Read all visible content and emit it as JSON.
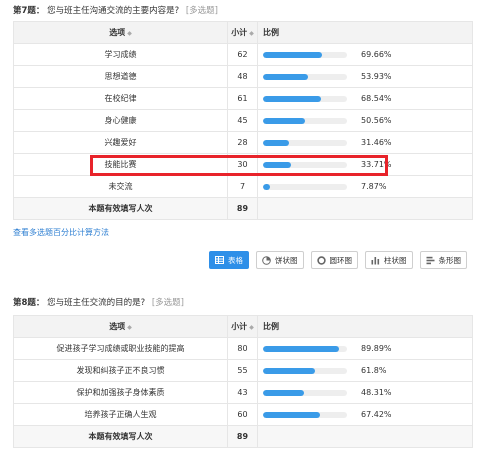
{
  "q7": {
    "number": "第7题：",
    "question": "您与班主任沟通交流的主要内容是?",
    "tag": "[多选题]",
    "headers": {
      "option": "选项",
      "count": "小计",
      "ratio": "比例"
    },
    "rows": [
      {
        "option": "学习成绩",
        "count": "62",
        "percent": "69.66%",
        "fill": 0.6966
      },
      {
        "option": "思想道德",
        "count": "48",
        "percent": "53.93%",
        "fill": 0.5393
      },
      {
        "option": "在校纪律",
        "count": "61",
        "percent": "68.54%",
        "fill": 0.6854
      },
      {
        "option": "身心健康",
        "count": "45",
        "percent": "50.56%",
        "fill": 0.5056
      },
      {
        "option": "兴趣爱好",
        "count": "28",
        "percent": "31.46%",
        "fill": 0.3146
      },
      {
        "option": "技能比赛",
        "count": "30",
        "percent": "33.71%",
        "fill": 0.3371
      },
      {
        "option": "未交流",
        "count": "7",
        "percent": "7.87%",
        "fill": 0.0787
      }
    ],
    "total_label": "本题有效填写人次",
    "total_value": "89",
    "highlighted_option": "技能比赛"
  },
  "multi_link": "查看多选题百分比计算方法",
  "toolbar": {
    "buttons": [
      {
        "label": "表格",
        "icon": "table-icon",
        "active": true
      },
      {
        "label": "饼状图",
        "icon": "pie-chart-icon",
        "active": false
      },
      {
        "label": "圆环图",
        "icon": "donut-chart-icon",
        "active": false
      },
      {
        "label": "柱状图",
        "icon": "bar-chart-icon",
        "active": false
      },
      {
        "label": "条形图",
        "icon": "horizontal-bar-chart-icon",
        "active": false
      }
    ]
  },
  "q8": {
    "number": "第8题：",
    "question": "您与班主任交流的目的是?",
    "tag": "[多选题]",
    "headers": {
      "option": "选项",
      "count": "小计",
      "ratio": "比例"
    },
    "rows": [
      {
        "option": "促进孩子学习成绩或职业技能的提高",
        "count": "80",
        "percent": "89.89%",
        "fill": 0.8989
      },
      {
        "option": "发现和纠孩子正不良习惯",
        "count": "55",
        "percent": "61.8%",
        "fill": 0.618
      },
      {
        "option": "保护和加强孩子身体素质",
        "count": "43",
        "percent": "48.31%",
        "fill": 0.4831
      },
      {
        "option": "培养孩子正确人生观",
        "count": "60",
        "percent": "67.42%",
        "fill": 0.6742
      }
    ],
    "total_label": "本题有效填写人次",
    "total_value": "89"
  },
  "colors": {
    "bar": "#3a9be8",
    "highlight": "#e8232a",
    "link": "#2e7fd2",
    "active_button": "#2e8fe8"
  }
}
